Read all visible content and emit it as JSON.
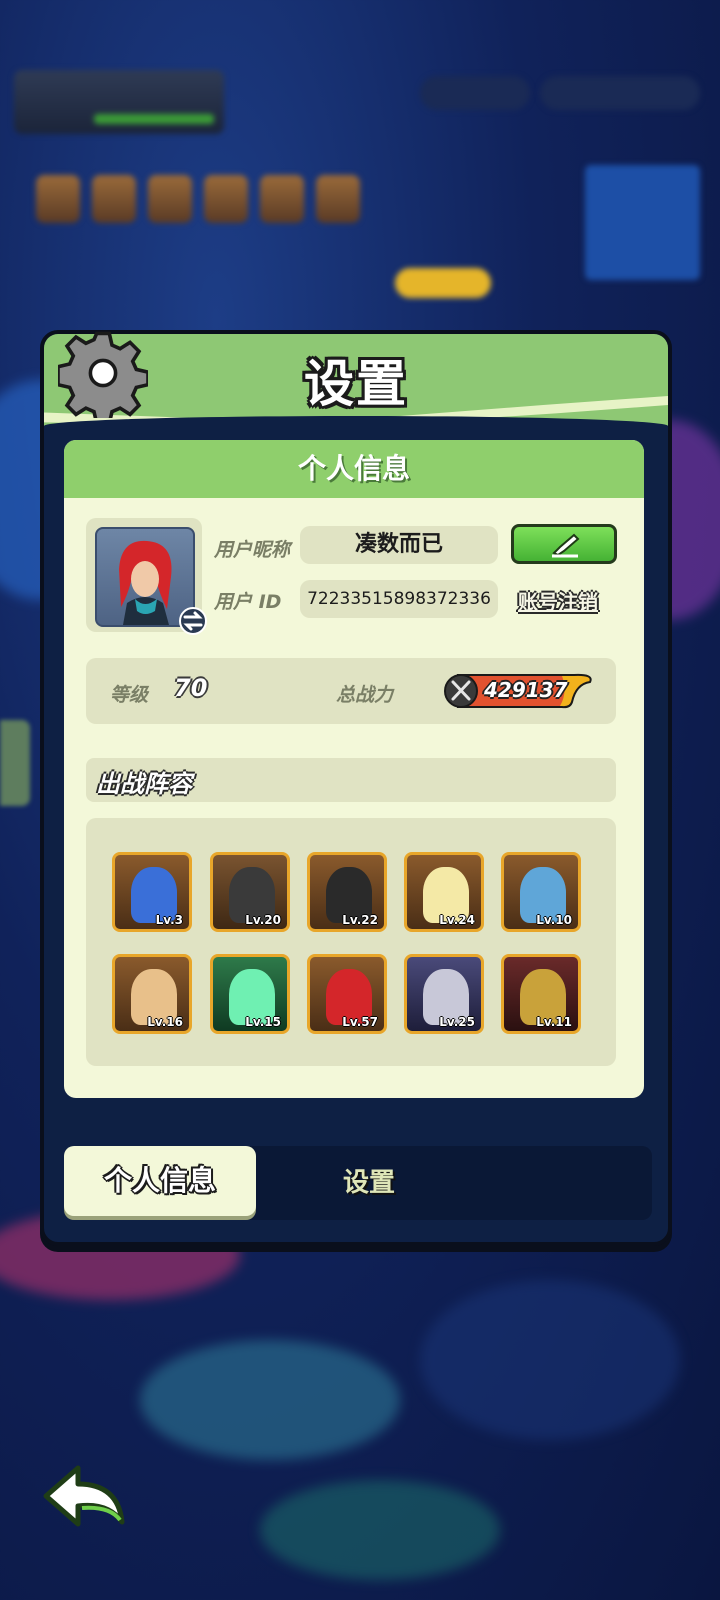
{
  "panel": {
    "title": "设置",
    "section_title": "个人信息"
  },
  "profile": {
    "nickname_label": "用户昵称",
    "nickname_value": "凑数而已",
    "id_label": "用户 ID",
    "id_value": "72233515898372336",
    "cancel_account_label": "账号注销",
    "level_label": "等级",
    "level_value": "70",
    "power_label": "总战力",
    "power_value": "429137"
  },
  "lineup": {
    "title": "出战阵容",
    "heroes": [
      {
        "level": "Lv.3"
      },
      {
        "level": "Lv.20"
      },
      {
        "level": "Lv.22"
      },
      {
        "level": "Lv.24"
      },
      {
        "level": "Lv.10"
      },
      {
        "level": "Lv.16"
      },
      {
        "level": "Lv.15"
      },
      {
        "level": "Lv.57"
      },
      {
        "level": "Lv.25"
      },
      {
        "level": "Lv.11"
      }
    ]
  },
  "tabs": {
    "active": "个人信息",
    "inactive": "设置"
  },
  "colors": {
    "header_green": "#8ec874",
    "panel_bg": "#0e2044",
    "content_bg": "#f3f8d9",
    "edit_button": "#45b234",
    "power_badge": "#e2522f",
    "hero_border": "#e8a62a"
  },
  "icons": [
    "gear-icon",
    "swap-icon",
    "pencil-icon",
    "crossed-swords-icon",
    "back-arrow-icon"
  ]
}
